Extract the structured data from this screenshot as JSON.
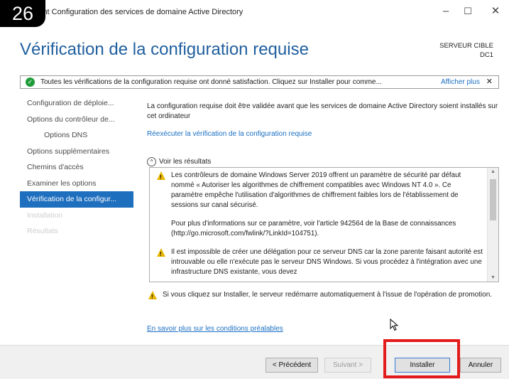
{
  "step_badge": "26",
  "window": {
    "title": "int Configuration des services de domaine Active Directory",
    "minimize": "–",
    "maximize": "☐",
    "close": "✕"
  },
  "page": {
    "title": "Vérification de la configuration requise",
    "target_label": "SERVEUR CIBLE",
    "target_value": "DC1"
  },
  "banner": {
    "icon": "check-circle-icon",
    "message": "Toutes les vérifications de la configuration requise ont donné satisfaction. Cliquez sur Installer pour comme...",
    "more_link": "Afficher plus",
    "close": "✕"
  },
  "sidebar": {
    "items": [
      {
        "label": "Configuration de déploie...",
        "state": "normal"
      },
      {
        "label": "Options du contrôleur de...",
        "state": "normal"
      },
      {
        "label": "Options DNS",
        "state": "indent"
      },
      {
        "label": "Options supplémentaires",
        "state": "normal"
      },
      {
        "label": "Chemins d'accès",
        "state": "normal"
      },
      {
        "label": "Examiner les options",
        "state": "normal"
      },
      {
        "label": "Vérification de la configur...",
        "state": "active"
      },
      {
        "label": "Installation",
        "state": "disabled"
      },
      {
        "label": "Résultats",
        "state": "disabled"
      }
    ]
  },
  "content": {
    "intro": "La configuration requise doit être validée avant que les services de domaine Active Directory soient installés sur cet ordinateur",
    "rerun_link": "Réexécuter la vérification de la configuration requise",
    "results_toggle": "Voir les résultats",
    "results": [
      {
        "warning": true,
        "text": "Les contrôleurs de domaine Windows Server 2019 offrent un paramètre de sécurité par défaut nommé « Autoriser les algorithmes de chiffrement compatibles avec Windows NT 4.0 ». Ce paramètre empêche l'utilisation d'algorithmes de chiffrement faibles lors de l'établissement de sessions sur canal sécurisé."
      },
      {
        "warning": false,
        "text": "Pour plus d'informations sur ce paramètre, voir l'article 942564 de la Base de connaissances (http://go.microsoft.com/fwlink/?LinkId=104751)."
      },
      {
        "warning": true,
        "text": "Il est impossible de créer une délégation pour ce serveur DNS car la zone parente faisant autorité est introuvable ou elle n'exécute pas le serveur DNS Windows. Si vous procédez à l'intégration avec une infrastructure DNS existante, vous devez"
      }
    ],
    "restart_note": "Si vous cliquez sur Installer, le serveur redémarre automatiquement à l'issue de l'opération de promotion.",
    "learn_more_link": "En savoir plus sur les conditions préalables"
  },
  "footer": {
    "prev": "< Précédent",
    "next": "Suivant >",
    "install": "Installer",
    "cancel": "Annuler"
  },
  "colors": {
    "accent": "#1f6fbf",
    "title_blue": "#1f5f9f",
    "link": "#1a6fc2",
    "highlight": "#e31b1b",
    "ok_green": "#1f9c3a",
    "warning": "#e8b600"
  }
}
